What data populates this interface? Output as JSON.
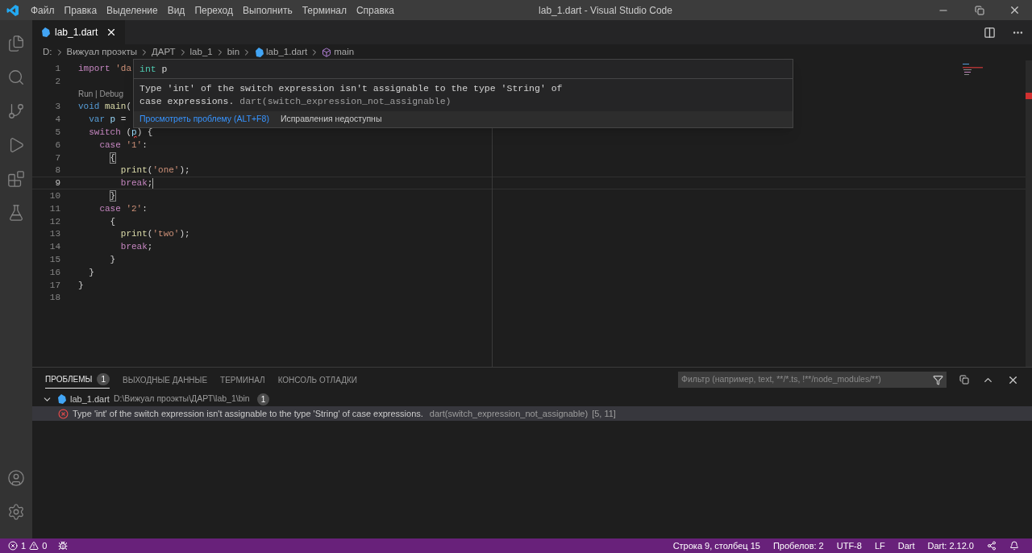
{
  "window": {
    "title": "lab_1.dart - Visual Studio Code"
  },
  "menu": [
    "Файл",
    "Правка",
    "Выделение",
    "Вид",
    "Переход",
    "Выполнить",
    "Терминал",
    "Справка"
  ],
  "activity_bar": [
    {
      "kind": "files",
      "selected": false
    },
    {
      "kind": "search",
      "selected": false
    },
    {
      "kind": "source-control",
      "selected": false
    },
    {
      "kind": "run",
      "selected": false
    },
    {
      "kind": "extensions",
      "selected": false
    },
    {
      "kind": "testing",
      "selected": false
    }
  ],
  "tabs": [
    {
      "label": "lab_1.dart",
      "selected": true
    }
  ],
  "breadcrumbs": [
    {
      "label": "D:",
      "kind": "folder"
    },
    {
      "label": "Вижуал проэкты",
      "kind": "folder"
    },
    {
      "label": "ДАРТ",
      "kind": "folder"
    },
    {
      "label": "lab_1",
      "kind": "folder"
    },
    {
      "label": "bin",
      "kind": "folder"
    },
    {
      "label": "lab_1.dart",
      "kind": "file"
    },
    {
      "label": "main",
      "kind": "symbol"
    }
  ],
  "editor": {
    "lines": [
      {
        "number": "1",
        "current": false,
        "tokens": [
          {
            "text": "import",
            "kind": "keyword"
          },
          {
            "text": " 'da",
            "kind": "string"
          }
        ]
      },
      {
        "number": "2",
        "current": false
      },
      {
        "number": "3",
        "current": false,
        "codelens": "Run | Debug",
        "tokens": [
          {
            "text": "void",
            "kind": "storage"
          },
          {
            "text": " main",
            "kind": "function"
          },
          {
            "text": "(",
            "kind": "plain"
          }
        ]
      },
      {
        "number": "4",
        "current": false,
        "tokens": [
          {
            "text": "  var",
            "kind": "storage"
          },
          {
            "text": " p",
            "kind": "variable"
          },
          {
            "text": " =",
            "kind": "plain"
          }
        ]
      },
      {
        "number": "5",
        "current": false,
        "tokens": [
          {
            "text": "  switch",
            "kind": "keyword"
          },
          {
            "text": " (",
            "kind": "plain"
          },
          {
            "text": "p",
            "kind": "error"
          },
          {
            "text": ") {",
            "kind": "plain"
          }
        ]
      },
      {
        "number": "6",
        "current": false,
        "tokens": [
          {
            "text": "    case",
            "kind": "keyword"
          },
          {
            "text": " '1'",
            "kind": "string"
          },
          {
            "text": ":",
            "kind": "plain"
          }
        ]
      },
      {
        "number": "7",
        "current": false,
        "tokens": [
          {
            "text": "      {",
            "kind": "bracket-match"
          }
        ]
      },
      {
        "number": "8",
        "current": false,
        "tokens": [
          {
            "text": "        print",
            "kind": "function"
          },
          {
            "text": "(",
            "kind": "plain"
          },
          {
            "text": "'one'",
            "kind": "string"
          },
          {
            "text": ");",
            "kind": "plain"
          }
        ]
      },
      {
        "number": "9",
        "current": true,
        "tokens": [
          {
            "text": "        break",
            "kind": "keyword"
          },
          {
            "text": ";",
            "kind": "plain"
          }
        ]
      },
      {
        "number": "10",
        "current": false,
        "tokens": [
          {
            "text": "      }",
            "kind": "bracket-match"
          }
        ]
      },
      {
        "number": "11",
        "current": false,
        "tokens": [
          {
            "text": "    case",
            "kind": "keyword"
          },
          {
            "text": " '2'",
            "kind": "string"
          },
          {
            "text": ":",
            "kind": "plain"
          }
        ]
      },
      {
        "number": "12",
        "current": false,
        "tokens": [
          {
            "text": "      {",
            "kind": "plain"
          }
        ]
      },
      {
        "number": "13",
        "current": false,
        "tokens": [
          {
            "text": "        print",
            "kind": "function"
          },
          {
            "text": "(",
            "kind": "plain"
          },
          {
            "text": "'two'",
            "kind": "string"
          },
          {
            "text": ");",
            "kind": "plain"
          }
        ]
      },
      {
        "number": "14",
        "current": false,
        "tokens": [
          {
            "text": "        break",
            "kind": "keyword"
          },
          {
            "text": ";",
            "kind": "plain"
          }
        ]
      },
      {
        "number": "15",
        "current": false,
        "tokens": [
          {
            "text": "      }",
            "kind": "plain"
          }
        ]
      },
      {
        "number": "16",
        "current": false,
        "tokens": [
          {
            "text": "  }",
            "kind": "plain"
          }
        ]
      },
      {
        "number": "17",
        "current": false,
        "tokens": [
          {
            "text": "}",
            "kind": "plain"
          }
        ]
      },
      {
        "number": "18",
        "current": false
      }
    ]
  },
  "hover": {
    "signature_type": "int",
    "signature_name": "p",
    "message": "Type 'int' of the switch expression isn't assignable to the type 'String' of case expressions.",
    "code": "dart(switch_expression_not_assignable)",
    "actions": [
      {
        "label": "Просмотреть проблему (ALT+F8)",
        "kind": "link"
      },
      {
        "label": "Исправления недоступны",
        "kind": "text"
      }
    ]
  },
  "panel": {
    "tabs": [
      {
        "label": "ПРОБЛЕМЫ",
        "badge": "1",
        "selected": true
      },
      {
        "label": "ВЫХОДНЫЕ ДАННЫЕ",
        "selected": false
      },
      {
        "label": "ТЕРМИНАЛ",
        "selected": false
      },
      {
        "label": "КОНСОЛЬ ОТЛАДКИ",
        "selected": false
      }
    ],
    "filter": {
      "placeholder": "Фильтр (например, text, **/*.ts, !**/node_modules/**)"
    },
    "groups": [
      {
        "file": "lab_1.dart",
        "path": "D:\\Вижуал проэкты\\ДАРТ\\lab_1\\bin",
        "count": "1",
        "expanded": true,
        "problems": [
          {
            "kind": "error",
            "selected": true,
            "message": "Type 'int' of the switch expression isn't assignable to the type 'String' of case expressions.",
            "source": "dart(switch_expression_not_assignable)",
            "position": "[5, 11]"
          }
        ]
      }
    ]
  },
  "status_bar": {
    "errors": "1",
    "warnings": "0",
    "right": [
      "Строка 9, столбец 15",
      "Пробелов: 2",
      "UTF-8",
      "LF",
      "Dart",
      "Dart: 2.12.0"
    ]
  }
}
